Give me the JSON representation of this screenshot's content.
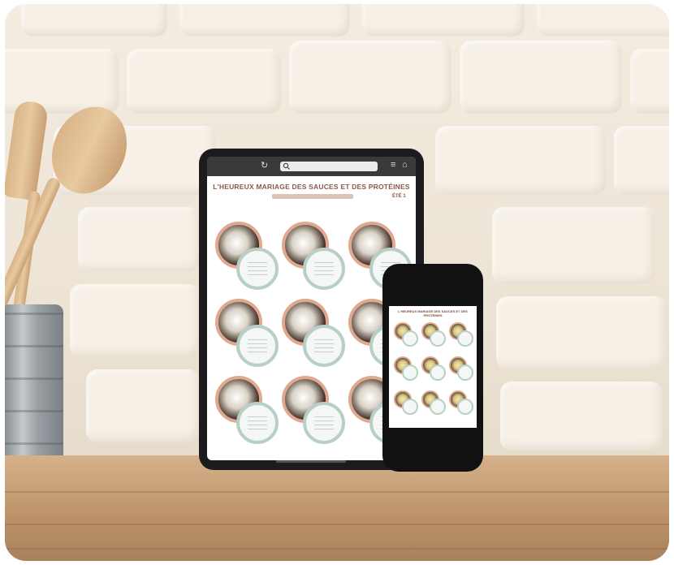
{
  "scene": {
    "description_ref": "photo",
    "colors": {
      "wall": "#f3ece0",
      "shelf": "#c39a70",
      "tablet_frame": "#1c1c1e",
      "accent_title": "#8a5a48",
      "dish_ring": "#e0a98f",
      "plate_ring": "#b7cfc4"
    }
  },
  "tablet": {
    "title": "L'HEUREUX MARIAGE DES SAUCES ET DES PROTÉINES",
    "corner_label": "ÉTÉ 1"
  },
  "phone": {
    "title": "L'HEUREUX MARIAGE DES SAUCES ET DES PROTÉINES"
  },
  "icons": [
    "search-icon",
    "home-icon",
    "menu-icon",
    "refresh-icon"
  ]
}
